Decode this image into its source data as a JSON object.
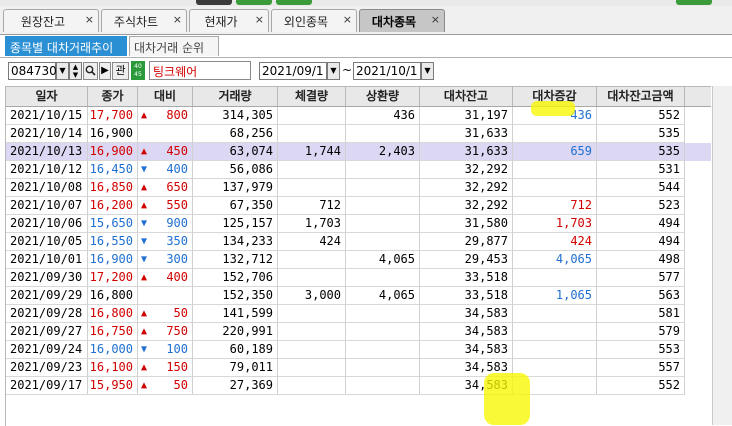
{
  "tabs": [
    {
      "label": "원장잔고",
      "close": "×"
    },
    {
      "label": "주식차트",
      "close": "×"
    },
    {
      "label": "현재가",
      "close": "×"
    },
    {
      "label": "외인종목",
      "close": "×"
    },
    {
      "label": "대차종목",
      "close": "×",
      "active": true
    }
  ],
  "subtabs": [
    {
      "label": "종목별 대차거래추이",
      "active": true
    },
    {
      "label": "대차거래 순위",
      "active": false
    }
  ],
  "toolbar": {
    "stock_code": "084730",
    "stock_name": "팅크웨어",
    "relation_button": "관",
    "logo_text": "40 45",
    "date_from": "2021/09/1",
    "date_to": "2021/10/1",
    "tilde": "~"
  },
  "table": {
    "columns": [
      "일자",
      "종가",
      "대비",
      "거래량",
      "체결량",
      "상환량",
      "대차잔고",
      "대차증감",
      "대차잔고금액"
    ],
    "rows": [
      {
        "date": "2021/10/15",
        "close": "17,700",
        "dir": "up",
        "chg": "800",
        "volume": "314,305",
        "exec": "",
        "repay": "436",
        "balance": "31,197",
        "delta": "436",
        "delta_dir": "dn",
        "amount": "552"
      },
      {
        "date": "2021/10/14",
        "close": "16,900",
        "dir": "none",
        "chg": "",
        "volume": "68,256",
        "exec": "",
        "repay": "",
        "balance": "31,633",
        "delta": "",
        "delta_dir": "none",
        "amount": "535"
      },
      {
        "date": "2021/10/13",
        "close": "16,900",
        "dir": "up",
        "chg": "450",
        "volume": "63,074",
        "exec": "1,744",
        "repay": "2,403",
        "balance": "31,633",
        "delta": "659",
        "delta_dir": "dn",
        "amount": "535",
        "selected": true
      },
      {
        "date": "2021/10/12",
        "close": "16,450",
        "dir": "dn",
        "chg": "400",
        "volume": "56,086",
        "exec": "",
        "repay": "",
        "balance": "32,292",
        "delta": "",
        "delta_dir": "none",
        "amount": "531"
      },
      {
        "date": "2021/10/08",
        "close": "16,850",
        "dir": "up",
        "chg": "650",
        "volume": "137,979",
        "exec": "",
        "repay": "",
        "balance": "32,292",
        "delta": "",
        "delta_dir": "none",
        "amount": "544"
      },
      {
        "date": "2021/10/07",
        "close": "16,200",
        "dir": "up",
        "chg": "550",
        "volume": "67,350",
        "exec": "712",
        "repay": "",
        "balance": "32,292",
        "delta": "712",
        "delta_dir": "up",
        "amount": "523"
      },
      {
        "date": "2021/10/06",
        "close": "15,650",
        "dir": "dn",
        "chg": "900",
        "volume": "125,157",
        "exec": "1,703",
        "repay": "",
        "balance": "31,580",
        "delta": "1,703",
        "delta_dir": "up",
        "amount": "494"
      },
      {
        "date": "2021/10/05",
        "close": "16,550",
        "dir": "dn",
        "chg": "350",
        "volume": "134,233",
        "exec": "424",
        "repay": "",
        "balance": "29,877",
        "delta": "424",
        "delta_dir": "up",
        "amount": "494"
      },
      {
        "date": "2021/10/01",
        "close": "16,900",
        "dir": "dn",
        "chg": "300",
        "volume": "132,712",
        "exec": "",
        "repay": "4,065",
        "balance": "29,453",
        "delta": "4,065",
        "delta_dir": "dn",
        "amount": "498"
      },
      {
        "date": "2021/09/30",
        "close": "17,200",
        "dir": "up",
        "chg": "400",
        "volume": "152,706",
        "exec": "",
        "repay": "",
        "balance": "33,518",
        "delta": "",
        "delta_dir": "none",
        "amount": "577"
      },
      {
        "date": "2021/09/29",
        "close": "16,800",
        "dir": "none",
        "chg": "",
        "volume": "152,350",
        "exec": "3,000",
        "repay": "4,065",
        "balance": "33,518",
        "delta": "1,065",
        "delta_dir": "dn",
        "amount": "563"
      },
      {
        "date": "2021/09/28",
        "close": "16,800",
        "dir": "up",
        "chg": "50",
        "volume": "141,599",
        "exec": "",
        "repay": "",
        "balance": "34,583",
        "delta": "",
        "delta_dir": "none",
        "amount": "581"
      },
      {
        "date": "2021/09/27",
        "close": "16,750",
        "dir": "up",
        "chg": "750",
        "volume": "220,991",
        "exec": "",
        "repay": "",
        "balance": "34,583",
        "delta": "",
        "delta_dir": "none",
        "amount": "579"
      },
      {
        "date": "2021/09/24",
        "close": "16,000",
        "dir": "dn",
        "chg": "100",
        "volume": "60,189",
        "exec": "",
        "repay": "",
        "balance": "34,583",
        "delta": "",
        "delta_dir": "none",
        "amount": "553"
      },
      {
        "date": "2021/09/23",
        "close": "16,100",
        "dir": "up",
        "chg": "150",
        "volume": "79,011",
        "exec": "",
        "repay": "",
        "balance": "34,583",
        "delta": "",
        "delta_dir": "none",
        "amount": "557"
      },
      {
        "date": "2021/09/17",
        "close": "15,950",
        "dir": "up",
        "chg": "50",
        "volume": "27,369",
        "exec": "",
        "repay": "",
        "balance": "34,583",
        "delta": "",
        "delta_dir": "none",
        "amount": "552"
      }
    ]
  },
  "colors": {
    "up": "#d10000",
    "down": "#1f6fd1",
    "selected_row": "#dcd7f2",
    "active_subtab": "#2a8fd3",
    "highlight": "#f7f700"
  },
  "icons": {
    "up_marker": "▲",
    "down_marker": "▼",
    "dropdown": "chevron-down-icon",
    "spin": "up-down-spinner-icon",
    "search": "search-icon",
    "next": "triangle-right-icon"
  }
}
